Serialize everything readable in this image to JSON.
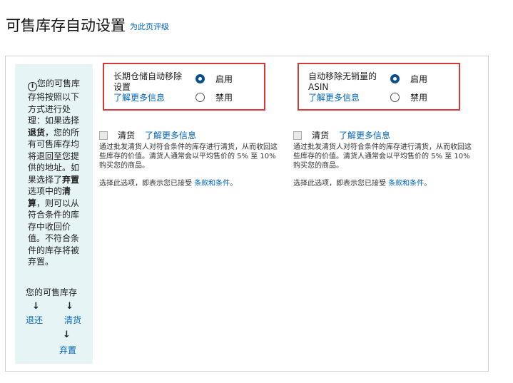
{
  "header": {
    "title": "可售库存自动设置",
    "rate_link": "为此页评级"
  },
  "info": {
    "icon": "info-icon",
    "p1": "您的可售库存将按照以下方式进行处理：如果选择",
    "b1": "退货",
    "p2": "，您的所有可售库存均将退回至您提供的地址。如果选择了",
    "b2": "弃置",
    "p3": "选项中的",
    "b3": "清算",
    "p4": "，则可以从符合条件的库存中收回价值。不符合条件的库存将被弃置。",
    "flow": {
      "top": "您的可售库存",
      "arrow": "↓",
      "return": "退还",
      "liquidate": "清货",
      "dispose": "弃置"
    }
  },
  "options": [
    {
      "label": "长期仓储自动移除设置",
      "learn_more": "了解更多信息",
      "enable": "启用",
      "disable": "禁用",
      "selected": "enable",
      "clear_label": "清货",
      "clear_learn_more": "了解更多信息",
      "description": "通过批发清货人对符合条件的库存进行清货，从而收回这些库存的价值。清货人通常会以平均售价的 5% 至 10% 购买您的商品。",
      "terms_prefix": "选择此选项，即表示您已接受",
      "terms_link": "条款和条件",
      "terms_suffix": "。"
    },
    {
      "label": "自动移除无销量的 ASIN",
      "learn_more": "了解更多信息",
      "enable": "启用",
      "disable": "禁用",
      "selected": "enable",
      "clear_label": "清货",
      "clear_learn_more": "了解更多信息",
      "description": "通过批发清货人对符合条件的库存进行清货，从而收回这些库存的价值。清货人通常会以平均售价的 5% 至 10% 购买您的商品。",
      "terms_prefix": "选择此选项，即表示您已接受",
      "terms_link": "条款和条件",
      "terms_suffix": "。"
    }
  ],
  "colors": {
    "link": "#0066c0",
    "highlight_border": "#d5393a",
    "info_bg": "#e7f4f6",
    "radio_on": "#0a4f8a"
  }
}
